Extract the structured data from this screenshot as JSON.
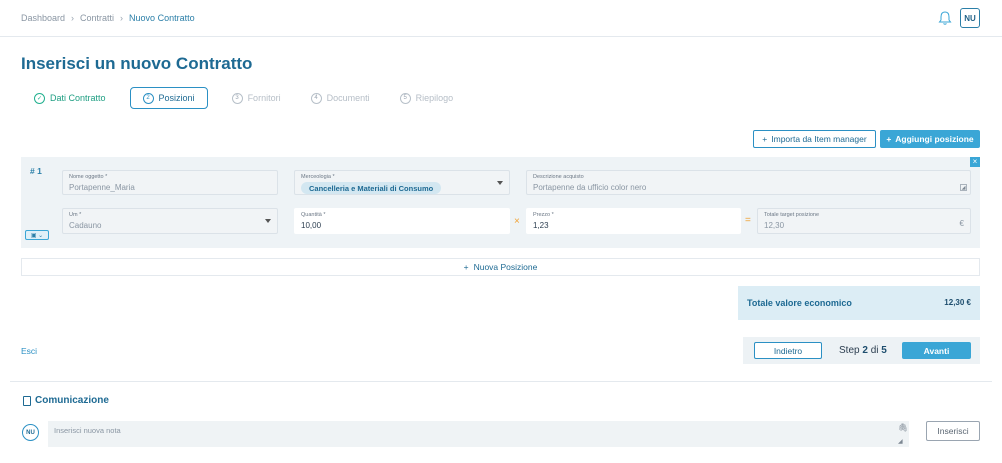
{
  "breadcrumb": [
    "Dashboard",
    "Contratti",
    "Nuovo Contratto"
  ],
  "user": {
    "initials": "NU"
  },
  "page_title": "Inserisci un nuovo Contratto",
  "steps": [
    {
      "num": "✓",
      "label": "Dati Contratto",
      "state": "done"
    },
    {
      "num": "2",
      "label": "Posizioni",
      "state": "active"
    },
    {
      "num": "3",
      "label": "Fornitori",
      "state": "todo"
    },
    {
      "num": "4",
      "label": "Documenti",
      "state": "todo"
    },
    {
      "num": "5",
      "label": "Riepilogo",
      "state": "todo"
    }
  ],
  "toolbar": {
    "import_label": "Importa da Item manager",
    "add_label": "Aggiungi posizione"
  },
  "position": {
    "number": "# 1",
    "nome": {
      "label": "Nome oggetto *",
      "value": "Portapenne_Maria"
    },
    "merceologia": {
      "label": "Merceologia *",
      "value": "Cancelleria e Materiali di Consumo"
    },
    "descrizione": {
      "label": "Descrizione acquisto",
      "value": "Portapenne da ufficio color nero"
    },
    "um": {
      "label": "Um *",
      "value": "Cadauno"
    },
    "quantita": {
      "label": "Quantità *",
      "value": "10,00"
    },
    "prezzo": {
      "label": "Prezzo *",
      "value": "1,23"
    },
    "totale": {
      "label": "Totale target posizione",
      "value": "12,30",
      "currency": "€"
    },
    "times_symbol": "×",
    "equals_symbol": "="
  },
  "new_position_label": "Nuova Posizione",
  "total": {
    "label": "Totale valore economico",
    "value": "12,30 €"
  },
  "nav": {
    "exit_label": "Esci",
    "back_label": "Indietro",
    "step_prefix": "Step",
    "step_current": "2",
    "step_sep": "di",
    "step_total": "5",
    "next_label": "Avanti"
  },
  "comunicazione": {
    "title": "Comunicazione",
    "placeholder": "Inserisci nuova nota",
    "submit_label": "Inserisci",
    "avatar": "NU"
  }
}
